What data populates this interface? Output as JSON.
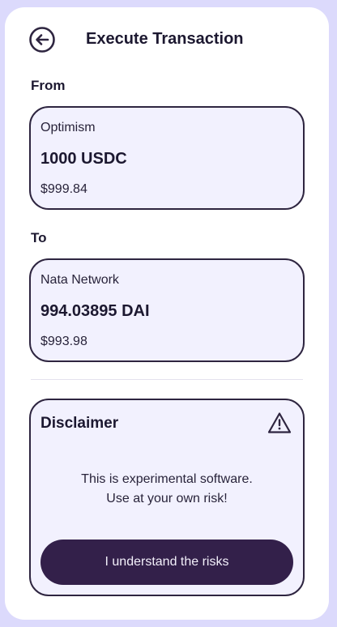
{
  "header": {
    "title": "Execute Transaction",
    "back_icon": "arrow-left-circle-icon"
  },
  "from": {
    "label": "From",
    "network": "Optimism",
    "amount": "1000 USDC",
    "usd_value": "$999.84"
  },
  "to": {
    "label": "To",
    "network": "Nata Network",
    "amount": "994.03895 DAI",
    "usd_value": "$993.98"
  },
  "disclaimer": {
    "title": "Disclaimer",
    "icon": "warning-triangle-icon",
    "message_line1": "This is experimental software.",
    "message_line2": "Use at your own risk!",
    "button_label": "I understand the risks"
  },
  "colors": {
    "background": "#dcdafc",
    "card": "#ffffff",
    "box_fill": "#f2f1fe",
    "border": "#2e2540",
    "button": "#33204a"
  }
}
